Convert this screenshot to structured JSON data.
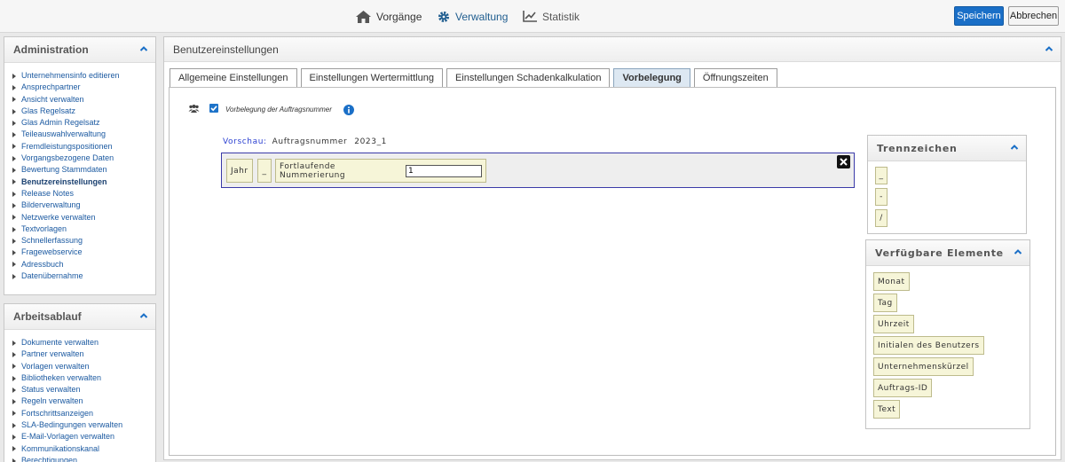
{
  "topnav": {
    "items": [
      {
        "label": "Vorgänge",
        "icon": "home-icon"
      },
      {
        "label": "Verwaltung",
        "icon": "gear-icon"
      },
      {
        "label": "Statistik",
        "icon": "chart-icon"
      }
    ],
    "save_label": "Speichern",
    "cancel_label": "Abbrechen"
  },
  "admin_panel": {
    "title": "Administration",
    "items": [
      "Unternehmensinfo editieren",
      "Ansprechpartner",
      "Ansicht verwalten",
      "Glas Regelsatz",
      "Glas Admin Regelsatz",
      "Teileauswahlverwaltung",
      "Fremdleistungspositionen",
      "Vorgangsbezogene Daten",
      "Bewertung Stammdaten",
      "Benutzereinstellungen",
      "Release Notes",
      "Bilderverwaltung",
      "Netzwerke verwalten",
      "Textvorlagen",
      "Schnellerfassung",
      "Fragewebservice",
      "Adressbuch",
      "Datenübernahme"
    ]
  },
  "workflow_panel": {
    "title": "Arbeitsablauf",
    "items": [
      "Dokumente verwalten",
      "Partner verwalten",
      "Vorlagen verwalten",
      "Bibliotheken verwalten",
      "Status verwalten",
      "Regeln verwalten",
      "Fortschrittsanzeigen",
      "SLA-Bedingungen verwalten",
      "E-Mail-Vorlagen verwalten",
      "Kommunikationskanal",
      "Berechtigungen"
    ]
  },
  "main": {
    "title": "Benutzereinstellungen",
    "tabs": [
      "Allgemeine Einstellungen",
      "Einstellungen Wertermittlung",
      "Einstellungen Schadenkalkulation",
      "Vorbelegung",
      "Öffnungszeiten"
    ],
    "checkbox_label": "Vorbelegung der Auftragsnummer",
    "preview_label": "Vorschau:",
    "preview_name": "Auftragsnummer",
    "preview_value": "2023_1",
    "tokens": {
      "jahr": "Jahr",
      "sep": "_",
      "counter": "Fortlaufende Nummerierung",
      "counter_value": "1"
    },
    "separators": {
      "title": "Trennzeichen",
      "items": [
        "_",
        "-",
        "/"
      ]
    },
    "elements": {
      "title": "Verfügbare Elemente",
      "items": [
        "Monat",
        "Tag",
        "Uhrzeit",
        "Initialen des Benutzers",
        "Unternehmenskürzel",
        "Auftrags-ID",
        "Text"
      ]
    }
  }
}
